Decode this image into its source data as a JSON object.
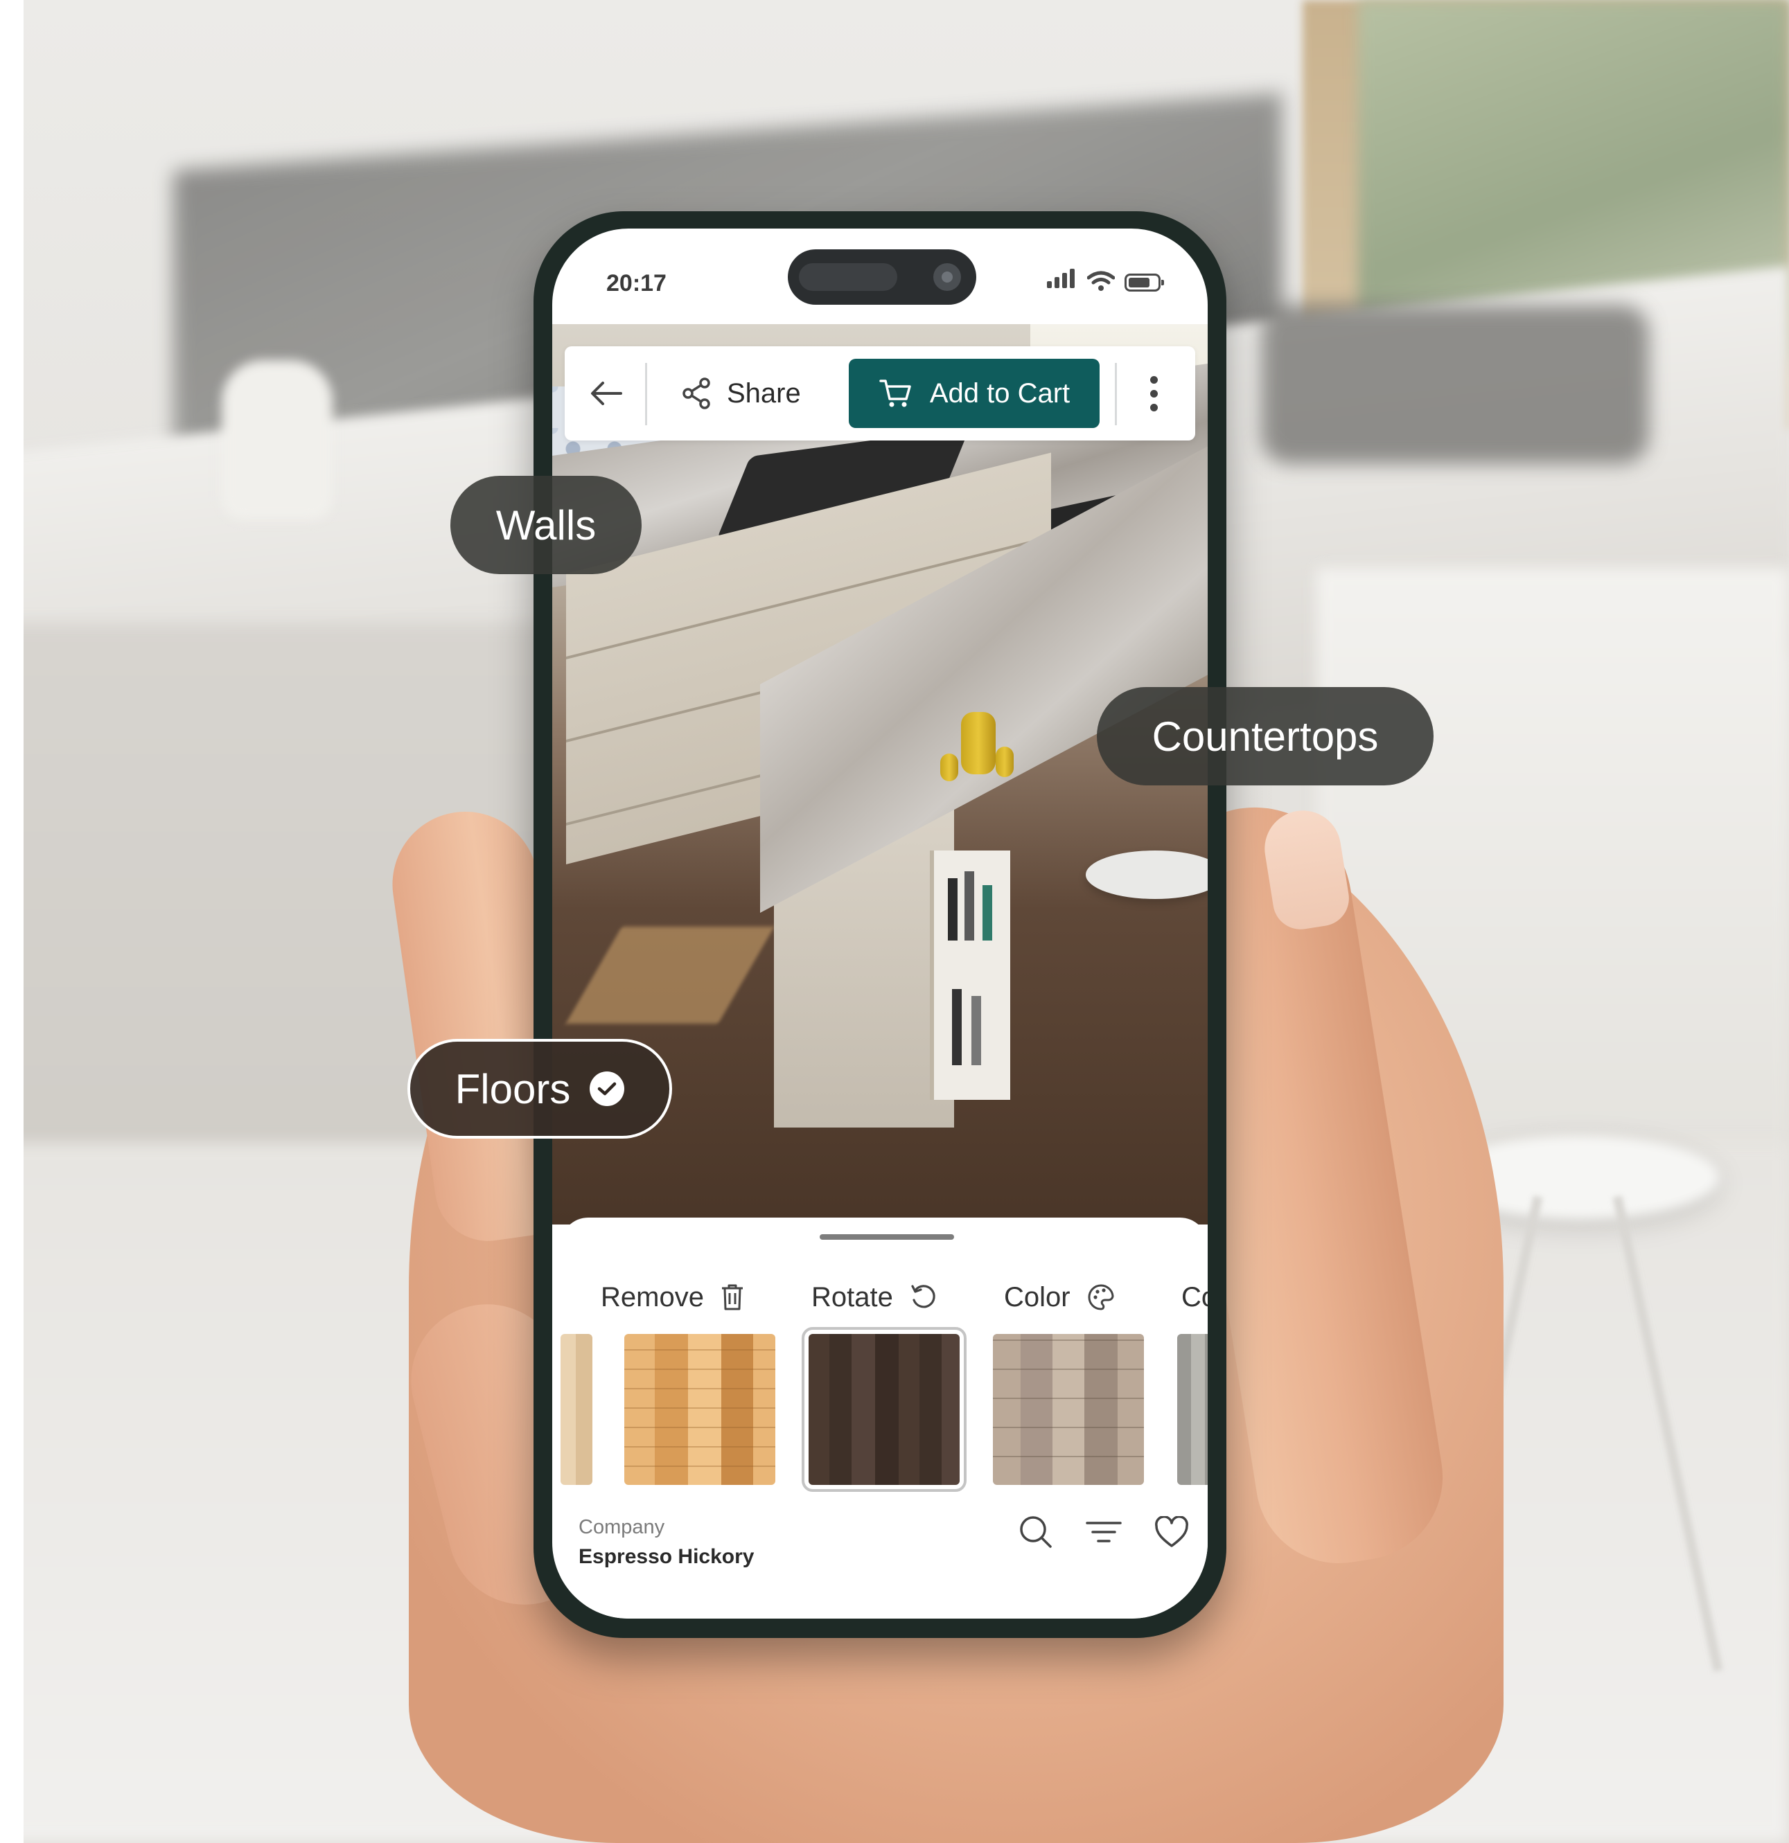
{
  "status_bar": {
    "time": "20:17"
  },
  "toolbar": {
    "share_label": "Share",
    "cart_label": "Add to Cart"
  },
  "chips": {
    "walls": "Walls",
    "countertops": "Countertops",
    "floors": "Floors"
  },
  "sheet": {
    "actions": [
      {
        "label": "Remove",
        "icon": "trash-icon"
      },
      {
        "label": "Rotate",
        "icon": "rotate-icon"
      },
      {
        "label": "Color",
        "icon": "palette-icon"
      },
      {
        "label": "Co",
        "icon": ""
      }
    ],
    "swatches": [
      {
        "name": "partial-light"
      },
      {
        "name": "honey-oak"
      },
      {
        "name": "espresso-hickory",
        "selected": true
      },
      {
        "name": "weathered-grey"
      },
      {
        "name": "partial-grey"
      }
    ],
    "product": {
      "brand": "Company",
      "name": "Espresso Hickory"
    },
    "icons": [
      "search-icon",
      "filter-icon",
      "heart-icon"
    ]
  },
  "colors": {
    "accent": "#0f5c5c",
    "chip_bg": "#373834",
    "sheet_bg": "#ffffff"
  }
}
